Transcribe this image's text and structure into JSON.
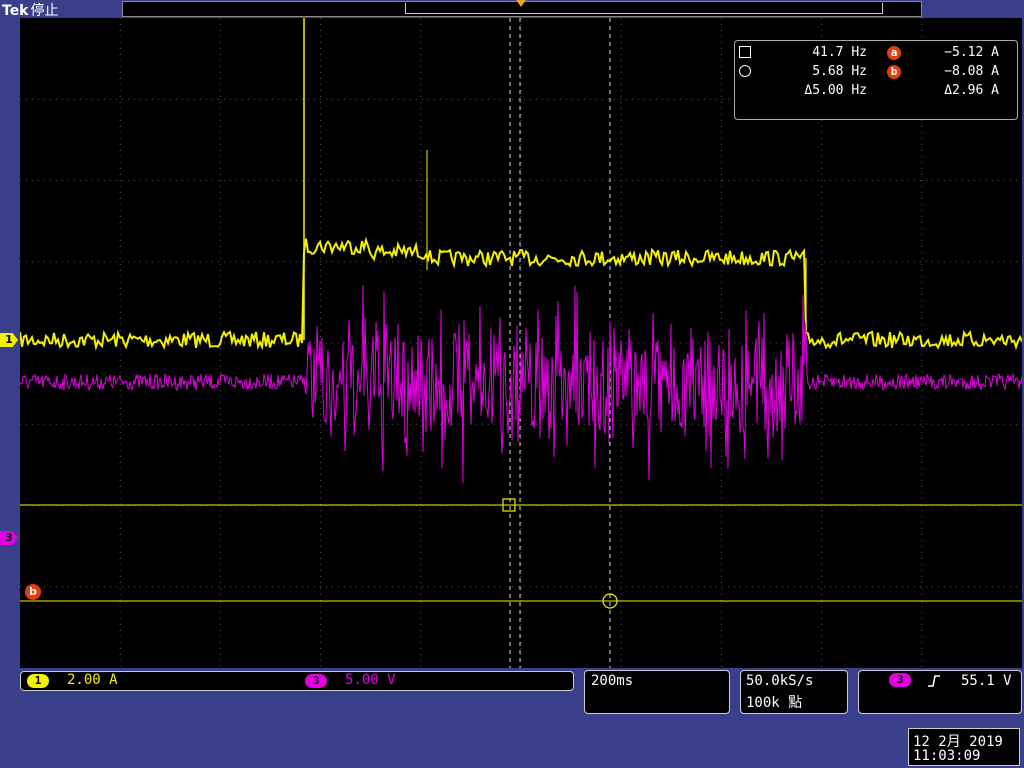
{
  "header": {
    "brand": "Tek",
    "state": "停止"
  },
  "measurements": {
    "row1": {
      "freq": "41.7 Hz",
      "cursor_label": "a",
      "cursor_value": "−5.12 A"
    },
    "row2": {
      "freq": "5.68 Hz",
      "cursor_label": "b",
      "cursor_value": "−8.08 A"
    },
    "row3": {
      "delta_freq": "Δ5.00 Hz",
      "delta_value": "Δ2.96 A"
    }
  },
  "markers": {
    "ch1": "1",
    "ch3": "3",
    "cursor_b": "b"
  },
  "channels": {
    "ch1": {
      "label": "1",
      "scale": "2.00 A",
      "color": "#f3f000"
    },
    "ch3": {
      "label": "3",
      "scale": "5.00 V",
      "color": "#e000e0"
    }
  },
  "timebase": {
    "value": "200ms"
  },
  "sampling": {
    "rate": "50.0kS/s",
    "points": "100k 點"
  },
  "trigger": {
    "source": "3",
    "slope_icon": "rising-edge-icon",
    "level": "55.1 V"
  },
  "datetime": {
    "date": "12 2月 2019",
    "time": "11:03:09"
  },
  "colors": {
    "ch1": "#f3f000",
    "ch3": "#e000e0",
    "cursor_badge": "#e23d12",
    "frame": "#3a3f8c"
  }
}
